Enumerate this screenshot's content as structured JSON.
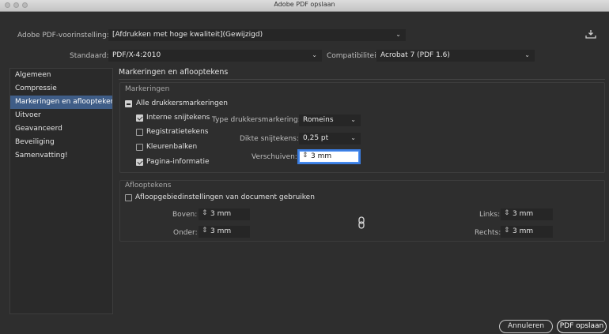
{
  "window": {
    "title": "Adobe PDF opslaan"
  },
  "top": {
    "preset_label": "Adobe PDF-voorinstelling:",
    "preset_value": "[Afdrukken met hoge kwaliteit](Gewijzigd)",
    "standard_label": "Standaard:",
    "standard_value": "PDF/X-4:2010",
    "compat_label": "Compatibiliteit:",
    "compat_value": "Acrobat 7 (PDF 1.6)"
  },
  "sidebar": {
    "items": [
      {
        "label": "Algemeen"
      },
      {
        "label": "Compressie"
      },
      {
        "label": "Markeringen en aflooptekens"
      },
      {
        "label": "Uitvoer"
      },
      {
        "label": "Geavanceerd"
      },
      {
        "label": "Beveiliging"
      },
      {
        "label": "Samenvatting!"
      }
    ],
    "active_index": 2
  },
  "panel": {
    "header": "Markeringen en aflooptekens",
    "marks": {
      "title": "Markeringen",
      "all_marks": "Alle drukkersmarkeringen",
      "trim_marks": "Interne snijtekens",
      "registration_marks": "Registratietekens",
      "color_bars": "Kleurenbalken",
      "page_info": "Pagina-informatie",
      "type_label": "Type drukkersmarkering:",
      "type_value": "Romeins",
      "weight_label": "Dikte snijtekens:",
      "weight_value": "0,25 pt",
      "offset_label": "Verschuiven:",
      "offset_value": "3 mm"
    },
    "bleeds": {
      "title": "Aflooptekens",
      "use_doc": "Afloopgebiedinstellingen van document gebruiken",
      "top_label": "Boven:",
      "top_value": "3 mm",
      "bottom_label": "Onder:",
      "bottom_value": "3 mm",
      "left_label": "Links:",
      "left_value": "3 mm",
      "right_label": "Rechts:",
      "right_value": "3 mm"
    }
  },
  "buttons": {
    "cancel": "Annuleren",
    "save": "PDF opslaan"
  }
}
